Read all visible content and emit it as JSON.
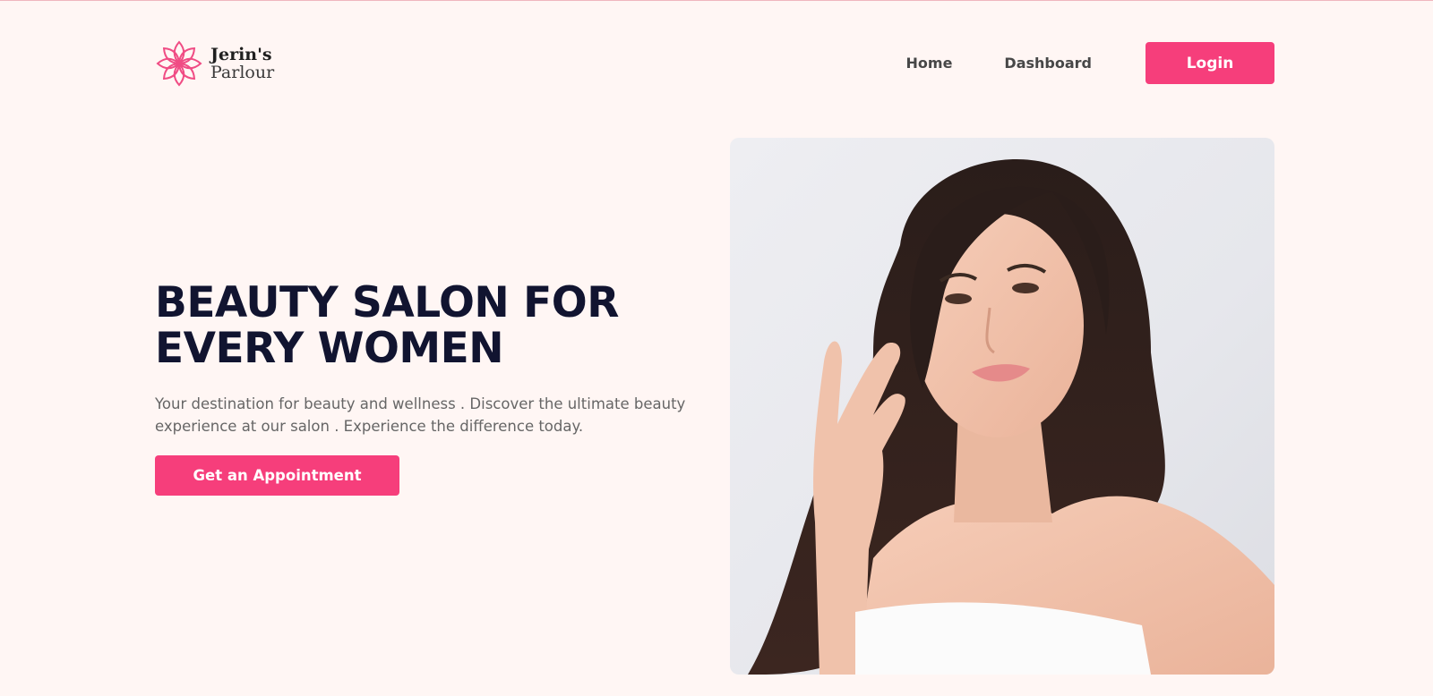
{
  "brand": {
    "name_line1": "Jerin's",
    "name_line2": "Parlour",
    "logo_icon": "lotus-flower-icon",
    "accent_color": "#f63e7b"
  },
  "nav": {
    "items": [
      {
        "label": "Home"
      },
      {
        "label": "Dashboard"
      }
    ],
    "login_label": "Login"
  },
  "hero": {
    "title_line1": "BEAUTY SALON FOR",
    "title_line2": "EVERY WOMEN",
    "description": "Your destination for beauty and wellness . Discover the ultimate beauty experience at our salon . Experience the difference today.",
    "cta_label": "Get an Appointment",
    "image_subject": "woman-portrait-photo"
  }
}
